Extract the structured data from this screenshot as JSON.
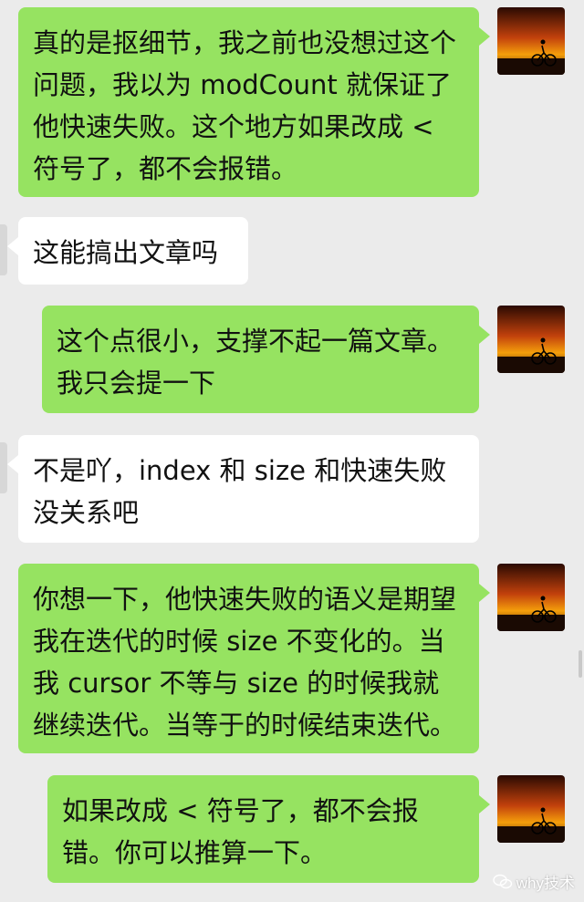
{
  "messages": [
    {
      "side": "sent",
      "text": "真的是抠细节，我之前也没想过这个问题，我以为 modCount 就保证了他快速失败。这个地方如果改成 < 符号了，都不会报错。"
    },
    {
      "side": "recv",
      "text": "这能搞出文章吗"
    },
    {
      "side": "sent",
      "text": "这个点很小，支撑不起一篇文章。我只会提一下"
    },
    {
      "side": "recv",
      "text": "不是吖，index 和 size 和快速失败没关系吧"
    },
    {
      "side": "sent",
      "text": "你想一下，他快速失败的语义是期望我在迭代的时候 size 不变化的。当我 cursor 不等与 size 的时候我就继续迭代。当等于的时候结束迭代。"
    },
    {
      "side": "sent",
      "text": "如果改成 < 符号了，都不会报错。你可以推算一下。"
    }
  ],
  "watermark": {
    "text": "why技术"
  },
  "colors": {
    "background": "#ebebeb",
    "sent_bubble": "#96e361",
    "recv_bubble": "#ffffff"
  },
  "icons": {
    "avatar": "sunset-cyclist-avatar",
    "watermark": "wechat-icon"
  }
}
